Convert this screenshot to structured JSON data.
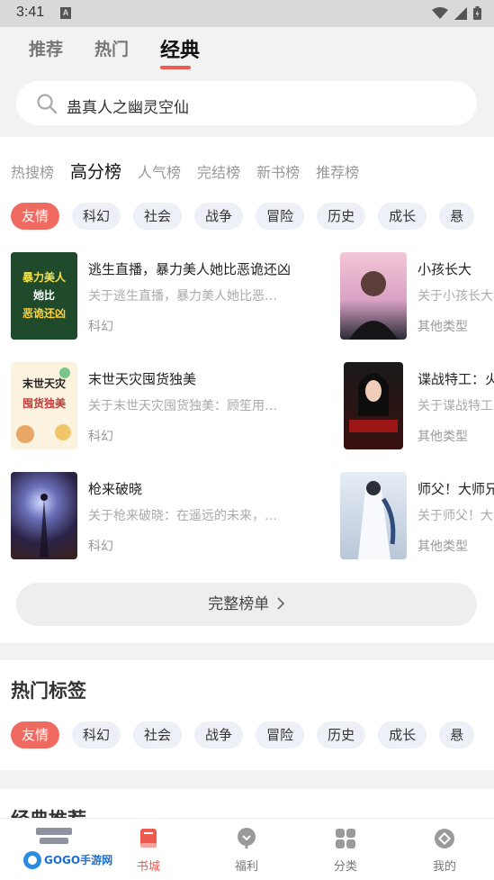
{
  "status": {
    "time": "3:41",
    "notif_letter": "A"
  },
  "tabs": [
    {
      "label": "推荐"
    },
    {
      "label": "热门"
    },
    {
      "label": "经典"
    }
  ],
  "search": {
    "text": "蛊真人之幽灵空仙"
  },
  "rank_tabs": [
    "热搜榜",
    "高分榜",
    "人气榜",
    "完结榜",
    "新书榜",
    "推荐榜"
  ],
  "chips": [
    "友情",
    "科幻",
    "社会",
    "战争",
    "冒险",
    "历史",
    "成长",
    "悬"
  ],
  "books_left": [
    {
      "title": "逃生直播，暴力美人她比恶诡还凶",
      "desc": "关于逃生直播，暴力美人她比恶…",
      "cat": "科幻",
      "cover_text": "暴力美人她比恶诡还凶"
    },
    {
      "title": "末世天灾囤货独美",
      "desc": "关于末世天灾囤货独美：顾笙用…",
      "cat": "科幻",
      "cover_text": "末世天灾囤货独美"
    },
    {
      "title": "枪来破晓",
      "desc": "关于枪来破晓：在遥远的未来，…",
      "cat": "科幻",
      "cover_text": ""
    }
  ],
  "books_right": [
    {
      "title": "小孩长大",
      "desc": "关于小孩长大",
      "cat": "其他类型"
    },
    {
      "title": "谍战特工：火",
      "desc": "关于谍战特工",
      "cat": "其他类型"
    },
    {
      "title": "师父！大师兄",
      "desc": "关于师父！大",
      "cat": "其他类型"
    }
  ],
  "full_list_label": "完整榜单",
  "hot_tags_title": "热门标签",
  "hot_tags": [
    "友情",
    "科幻",
    "社会",
    "战争",
    "冒险",
    "历史",
    "成长",
    "悬"
  ],
  "classic_title": "经典推荐",
  "nav": [
    {
      "label": "GOGO手游网",
      "icon": "gogo-logo"
    },
    {
      "label": "书城",
      "icon": "book-icon"
    },
    {
      "label": "福利",
      "icon": "gift-icon"
    },
    {
      "label": "分类",
      "icon": "grid-icon"
    },
    {
      "label": "我的",
      "icon": "profile-icon"
    }
  ],
  "colors": {
    "accent": "#ef5a50",
    "chip_bg": "#eef0f7"
  }
}
